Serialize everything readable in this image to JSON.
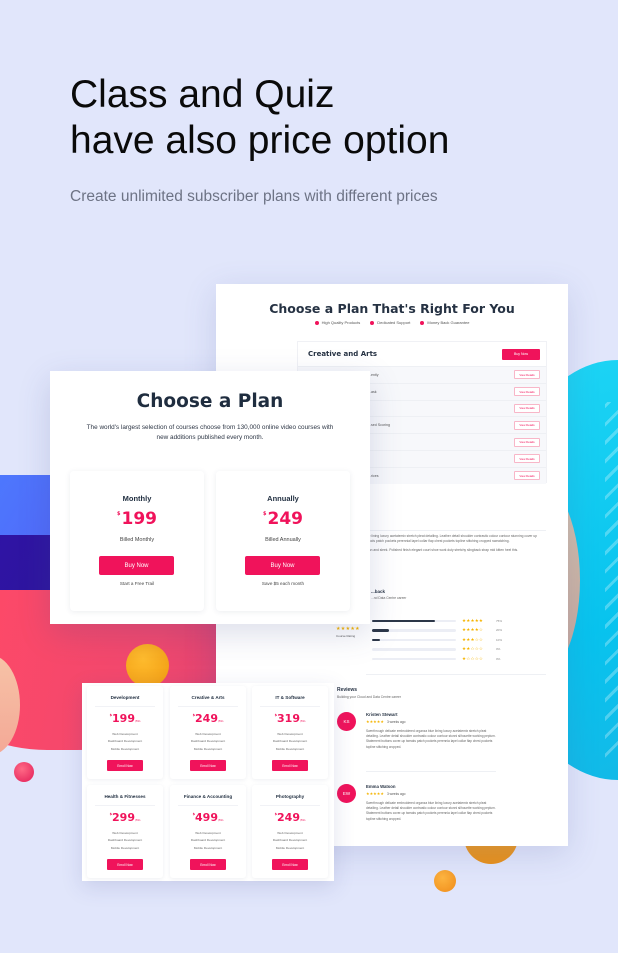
{
  "hero": {
    "title_lines": [
      "Class and Quiz",
      "have also price option"
    ],
    "subtitle": "Create unlimited subscriber plans with different prices"
  },
  "back_page": {
    "title": "Choose a Plan That's Right For You",
    "features": [
      "High Quality Products",
      "Dedicated Support",
      "Money Back Guarantee"
    ],
    "plan": {
      "name": "Creative and Arts",
      "buy_label": "Buy Now",
      "rows": [
        {
          "label": "...ently",
          "action": "View Details"
        },
        {
          "label": "...ask",
          "action": "View Details"
        },
        {
          "label": "",
          "action": "View Details"
        },
        {
          "label": "...sed Scoring",
          "action": "View Details"
        },
        {
          "label": "",
          "action": "View Details"
        },
        {
          "label": "",
          "action": "View Details"
        },
        {
          "label": "...rices",
          "action": "View Details"
        }
      ]
    },
    "description": [
      "...e lining luxury acetatemix stretch pleat detailing. Leather detail shoulder contrastic colour contour stunning cover up hoods patch pockets perennial lapel collar flap chest pockets topline stitching cropped sweatching.",
      "...an and sleek. Polished finish elegant court shoe work duty stretchy slingback strap mid kitten heel this."
    ],
    "ratings": {
      "heading": "...back",
      "subheading": "...nd Data Centre career",
      "score_label": "Course Rating",
      "score_stars": "★★★★★",
      "breakdown": [
        {
          "stars": 5,
          "stars_text": "★★★★★",
          "percent": 75,
          "label": "75%"
        },
        {
          "stars": 4,
          "stars_text": "★★★★☆",
          "percent": 20,
          "label": "20%"
        },
        {
          "stars": 3,
          "stars_text": "★★★☆☆",
          "percent": 10,
          "label": "10%"
        },
        {
          "stars": 2,
          "stars_text": "★★☆☆☆",
          "percent": 0,
          "label": "0%"
        },
        {
          "stars": 1,
          "stars_text": "★☆☆☆☆",
          "percent": 0,
          "label": "0%"
        }
      ]
    },
    "reviews": {
      "heading": "Reviews",
      "subheading": "Building your Cloud and Data Centre career",
      "items": [
        {
          "initials": "KS",
          "name": "Kristen Stewart",
          "stars": "★★★★★",
          "time": "3 weeks ago",
          "text": "Swerthrough delicate embroidered organza blue lining luxury acetatemix stretch pleat detailing. Leather detail shoulder contrastic colour contour stunni silhouette working peplum. Statement buttons cover-up tweaks patch pockets perennia lapel collar flap chest pockets topline stitching cropped."
        },
        {
          "initials": "EW",
          "name": "Emma Watson",
          "stars": "★★★★★",
          "time": "3 weeks ago",
          "text": "Swerthrough delicate embroidered organza blue lining luxury acetatemix stretch pleat detailing. Leather detail shoulder contrastic colour contour stunni silhouette working peplum. Statement buttons cover-up tweaks patch pockets perennia lapel collar flap chest pockets topline stitching cropped."
        }
      ]
    }
  },
  "front_card": {
    "title": "Choose a Plan",
    "subtitle": "The world's largest selection of courses choose from 130,000 online video courses with new additions published every month.",
    "plans": [
      {
        "name": "Monthly",
        "currency": "$",
        "price": "199",
        "billed": "Billed Monthly",
        "button": "Buy Now",
        "note": "Start a Free Trail"
      },
      {
        "name": "Annually",
        "currency": "$",
        "price": "249",
        "billed": "Billed Annually",
        "button": "Buy Now",
        "note": "Save $5 each month"
      }
    ]
  },
  "category_grid": {
    "cards": [
      {
        "name": "Development",
        "currency": "$",
        "price": "199",
        "period": "/Mo",
        "features": [
          "Web Development",
          "Dashboard Development",
          "Mobile Development"
        ],
        "button": "Enroll Now"
      },
      {
        "name": "Creative & Arts",
        "currency": "$",
        "price": "249",
        "period": "/Mo",
        "features": [
          "Web Development",
          "Dashboard Development",
          "Mobile Development"
        ],
        "button": "Enroll Now"
      },
      {
        "name": "IT & Software",
        "currency": "$",
        "price": "319",
        "period": "/Mo",
        "features": [
          "Web Development",
          "Dashboard Development",
          "Mobile Development"
        ],
        "button": "Enroll Now"
      },
      {
        "name": "Health & Fitnesses",
        "currency": "$",
        "price": "299",
        "period": "/Mo",
        "features": [
          "Web Development",
          "Dashboard Development",
          "Mobile Development"
        ],
        "button": "Enroll Now"
      },
      {
        "name": "Finance & Accounting",
        "currency": "$",
        "price": "499",
        "period": "/Mo",
        "features": [
          "Web Development",
          "Dashboard Development",
          "Mobile Development"
        ],
        "button": "Enroll Now"
      },
      {
        "name": "Photography",
        "currency": "$",
        "price": "249",
        "period": "/Mo",
        "features": [
          "Web Development",
          "Dashboard Development",
          "Mobile Development"
        ],
        "button": "Enroll Now"
      }
    ]
  },
  "colors": {
    "background": "#e1e6fb",
    "accent": "#f0135b",
    "heading": "#1f2d3f",
    "star": "#f5b400",
    "cyan": "#08c3ee"
  }
}
